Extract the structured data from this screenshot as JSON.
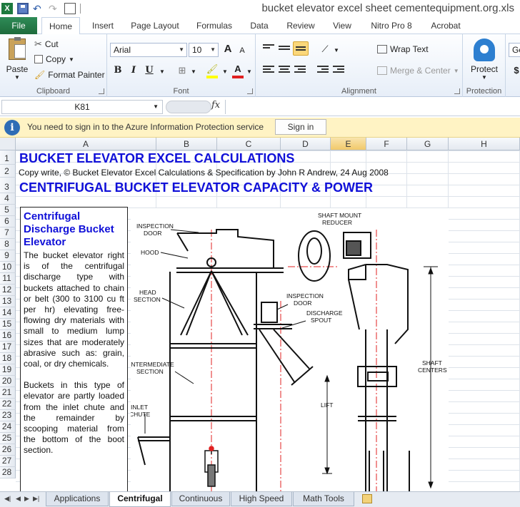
{
  "window": {
    "title": "bucket elevator excel sheet cementequipment.org.xls",
    "app_logo": "X"
  },
  "ribbon_tabs": [
    "File",
    "Home",
    "Insert",
    "Page Layout",
    "Formulas",
    "Data",
    "Review",
    "View",
    "Nitro Pro 8",
    "Acrobat"
  ],
  "clipboard": {
    "paste": "Paste",
    "cut": "Cut",
    "copy": "Copy",
    "format_painter": "Format Painter",
    "label": "Clipboard"
  },
  "font": {
    "name": "Arial",
    "size": "10",
    "bold": "B",
    "italic": "I",
    "underline": "U",
    "grow": "A",
    "shrink": "A",
    "font_color": "A",
    "label": "Font"
  },
  "alignment": {
    "wrap_text": "Wrap Text",
    "merge_center": "Merge & Center",
    "label": "Alignment"
  },
  "protection": {
    "protect": "Protect",
    "label": "Protection"
  },
  "number": {
    "general_partial": "Ge",
    "currency_partial": "$"
  },
  "formula_bar": {
    "name_box": "K81",
    "fx": "fx"
  },
  "info_bar": {
    "icon": "i",
    "message": "You need to sign in to the Azure Information Protection service",
    "sign_in": "Sign in"
  },
  "columns": [
    "A",
    "B",
    "C",
    "D",
    "E",
    "F",
    "G",
    "H"
  ],
  "selected_column": "E",
  "rows": [
    "1",
    "2",
    "3",
    "4",
    "5",
    "6",
    "7",
    "8",
    "9",
    "10",
    "11",
    "12",
    "13",
    "14",
    "15",
    "16",
    "17",
    "18",
    "19",
    "20",
    "21",
    "22",
    "23",
    "24",
    "25",
    "26",
    "27",
    "28"
  ],
  "cells": {
    "a1": "BUCKET ELEVATOR EXCEL CALCULATIONS",
    "a2": "Copy write,  © Bucket Elevator Excel Calculations & Specification by John R Andrew, 24 Aug 2008",
    "a3": "CENTRIFUGAL BUCKET ELEVATOR CAPACITY & POWER"
  },
  "textbox": {
    "title": "Centrifugal Discharge Bucket Elevator",
    "para1": "The bucket elevator right is of the centrifugal discharge type with buckets attached to chain or belt (300 to 3100 cu ft per hr) elevating free-flowing dry materials with small to medium lump sizes that are moderately abrasive such as: grain, coal, or dry chemicals.",
    "para2": "Buckets in this type of elevator are partly loaded from the inlet chute and the remainder by scooping material from the bottom of the boot section."
  },
  "drawing_labels": {
    "inspection_door_1": [
      "INSPECTION",
      "DOOR"
    ],
    "hood": "HOOD",
    "head_section": [
      "HEAD",
      "SECTION"
    ],
    "intermediate_section": [
      "INTERMEDIATE",
      "SECTION"
    ],
    "inlet_chute": [
      "INLET",
      "CHUTE"
    ],
    "shaft_mount_reducer": [
      "SHAFT MOUNT",
      "REDUCER"
    ],
    "inspection_door_2": [
      "INSPECTION",
      "DOOR"
    ],
    "discharge_spout": [
      "DISCHARGE",
      "SPOUT"
    ],
    "lift": "LIFT",
    "shaft_centers": [
      "SHAFT",
      "CENTERS"
    ]
  },
  "sheet_tabs": [
    "Applications",
    "Centrifugal",
    "Continuous",
    "High Speed",
    "Math Tools"
  ],
  "active_sheet": "Centrifugal",
  "colors": {
    "title_blue": "#1010d8",
    "file_tab_green": "#217346",
    "info_bar_yellow": "#fff3c4",
    "centerline_red": "#e02020"
  }
}
